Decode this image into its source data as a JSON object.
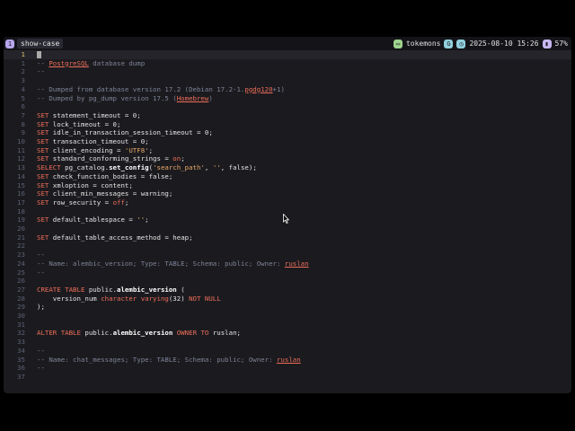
{
  "statusbar": {
    "session_index": "1",
    "session_name": "show-case",
    "host": "tokemons",
    "host_badge": "G",
    "datetime": "2025-08-10 15:26",
    "battery": "57%"
  },
  "editor": {
    "current_line": 1,
    "lines": [
      {
        "n": "1",
        "cursor": true,
        "segs": []
      },
      {
        "n": "1",
        "segs": [
          {
            "c": "cm",
            "t": "-- "
          },
          {
            "c": "ul",
            "t": "PostgreSQL"
          },
          {
            "c": "cm",
            "t": " database dump"
          }
        ]
      },
      {
        "n": "2",
        "segs": [
          {
            "c": "cm",
            "t": "--"
          }
        ]
      },
      {
        "n": "3",
        "segs": []
      },
      {
        "n": "4",
        "segs": [
          {
            "c": "cm",
            "t": "-- Dumped from database version 17.2 (Debian 17.2-1."
          },
          {
            "c": "ul",
            "t": "pgdg120"
          },
          {
            "c": "cm",
            "t": "+1)"
          }
        ]
      },
      {
        "n": "5",
        "segs": [
          {
            "c": "cm",
            "t": "-- Dumped by pg_dump version 17.5 ("
          },
          {
            "c": "ul",
            "t": "Homebrew"
          },
          {
            "c": "cm",
            "t": ")"
          }
        ]
      },
      {
        "n": "6",
        "segs": []
      },
      {
        "n": "7",
        "segs": [
          {
            "c": "kw",
            "t": "SET"
          },
          {
            "c": "",
            "t": " statement_timeout = 0;"
          }
        ]
      },
      {
        "n": "8",
        "segs": [
          {
            "c": "kw",
            "t": "SET"
          },
          {
            "c": "",
            "t": " lock_timeout = 0;"
          }
        ]
      },
      {
        "n": "9",
        "segs": [
          {
            "c": "kw",
            "t": "SET"
          },
          {
            "c": "",
            "t": " idle_in_transaction_session_timeout = 0;"
          }
        ]
      },
      {
        "n": "10",
        "segs": [
          {
            "c": "kw",
            "t": "SET"
          },
          {
            "c": "",
            "t": " transaction_timeout = 0;"
          }
        ]
      },
      {
        "n": "11",
        "segs": [
          {
            "c": "kw",
            "t": "SET"
          },
          {
            "c": "",
            "t": " client_encoding = "
          },
          {
            "c": "str",
            "t": "'UTF8'"
          },
          {
            "c": "",
            "t": ";"
          }
        ]
      },
      {
        "n": "12",
        "segs": [
          {
            "c": "kw",
            "t": "SET"
          },
          {
            "c": "",
            "t": " standard_conforming_strings = "
          },
          {
            "c": "kw",
            "t": "on"
          },
          {
            "c": "",
            "t": ";"
          }
        ]
      },
      {
        "n": "13",
        "segs": [
          {
            "c": "kw",
            "t": "SELECT"
          },
          {
            "c": "",
            "t": " pg_catalog."
          },
          {
            "c": "fn",
            "t": "set_config"
          },
          {
            "c": "",
            "t": "("
          },
          {
            "c": "str",
            "t": "'search_path'"
          },
          {
            "c": "",
            "t": ", "
          },
          {
            "c": "str",
            "t": "''"
          },
          {
            "c": "",
            "t": ", false);"
          }
        ]
      },
      {
        "n": "14",
        "segs": [
          {
            "c": "kw",
            "t": "SET"
          },
          {
            "c": "",
            "t": " check_function_bodies = false;"
          }
        ]
      },
      {
        "n": "15",
        "segs": [
          {
            "c": "kw",
            "t": "SET"
          },
          {
            "c": "",
            "t": " xmloption = content;"
          }
        ]
      },
      {
        "n": "16",
        "segs": [
          {
            "c": "kw",
            "t": "SET"
          },
          {
            "c": "",
            "t": " client_min_messages = warning;"
          }
        ]
      },
      {
        "n": "17",
        "segs": [
          {
            "c": "kw",
            "t": "SET"
          },
          {
            "c": "",
            "t": " row_security = "
          },
          {
            "c": "kw",
            "t": "off"
          },
          {
            "c": "",
            "t": ";"
          }
        ]
      },
      {
        "n": "18",
        "segs": []
      },
      {
        "n": "19",
        "segs": [
          {
            "c": "kw",
            "t": "SET"
          },
          {
            "c": "",
            "t": " default_tablespace = "
          },
          {
            "c": "str",
            "t": "''"
          },
          {
            "c": "",
            "t": ";"
          }
        ]
      },
      {
        "n": "20",
        "segs": []
      },
      {
        "n": "21",
        "segs": [
          {
            "c": "kw",
            "t": "SET"
          },
          {
            "c": "",
            "t": " default_table_access_method = heap;"
          }
        ]
      },
      {
        "n": "22",
        "segs": []
      },
      {
        "n": "23",
        "segs": [
          {
            "c": "cm",
            "t": "--"
          }
        ]
      },
      {
        "n": "24",
        "segs": [
          {
            "c": "cm",
            "t": "-- Name: alembic_version; Type: TABLE; Schema: public; Owner: "
          },
          {
            "c": "ul",
            "t": "ruslan"
          }
        ]
      },
      {
        "n": "25",
        "segs": [
          {
            "c": "cm",
            "t": "--"
          }
        ]
      },
      {
        "n": "26",
        "segs": []
      },
      {
        "n": "27",
        "segs": [
          {
            "c": "kw",
            "t": "CREATE TABLE"
          },
          {
            "c": "",
            "t": " public."
          },
          {
            "c": "fn",
            "t": "alembic_version"
          },
          {
            "c": "",
            "t": " ("
          }
        ]
      },
      {
        "n": "28",
        "segs": [
          {
            "c": "",
            "t": "    version_num "
          },
          {
            "c": "ty",
            "t": "character varying"
          },
          {
            "c": "",
            "t": "(32) "
          },
          {
            "c": "kw",
            "t": "NOT NULL"
          }
        ]
      },
      {
        "n": "29",
        "segs": [
          {
            "c": "",
            "t": ");"
          }
        ]
      },
      {
        "n": "30",
        "segs": []
      },
      {
        "n": "31",
        "segs": []
      },
      {
        "n": "32",
        "segs": [
          {
            "c": "kw",
            "t": "ALTER TABLE"
          },
          {
            "c": "",
            "t": " public."
          },
          {
            "c": "fn",
            "t": "alembic_version"
          },
          {
            "c": "",
            "t": " "
          },
          {
            "c": "kw",
            "t": "OWNER TO"
          },
          {
            "c": "",
            "t": " ruslan;"
          }
        ]
      },
      {
        "n": "33",
        "segs": []
      },
      {
        "n": "34",
        "segs": [
          {
            "c": "cm",
            "t": "--"
          }
        ]
      },
      {
        "n": "35",
        "segs": [
          {
            "c": "cm",
            "t": "-- Name: chat_messages; Type: TABLE; Schema: public; Owner: "
          },
          {
            "c": "ul",
            "t": "ruslan"
          }
        ]
      },
      {
        "n": "36",
        "segs": [
          {
            "c": "cm",
            "t": "--"
          }
        ]
      },
      {
        "n": "37",
        "segs": []
      }
    ]
  },
  "icons": {
    "session": "tmux-session-icon",
    "host": "computer-icon",
    "clock": "calendar-clock-icon",
    "battery": "battery-icon"
  }
}
